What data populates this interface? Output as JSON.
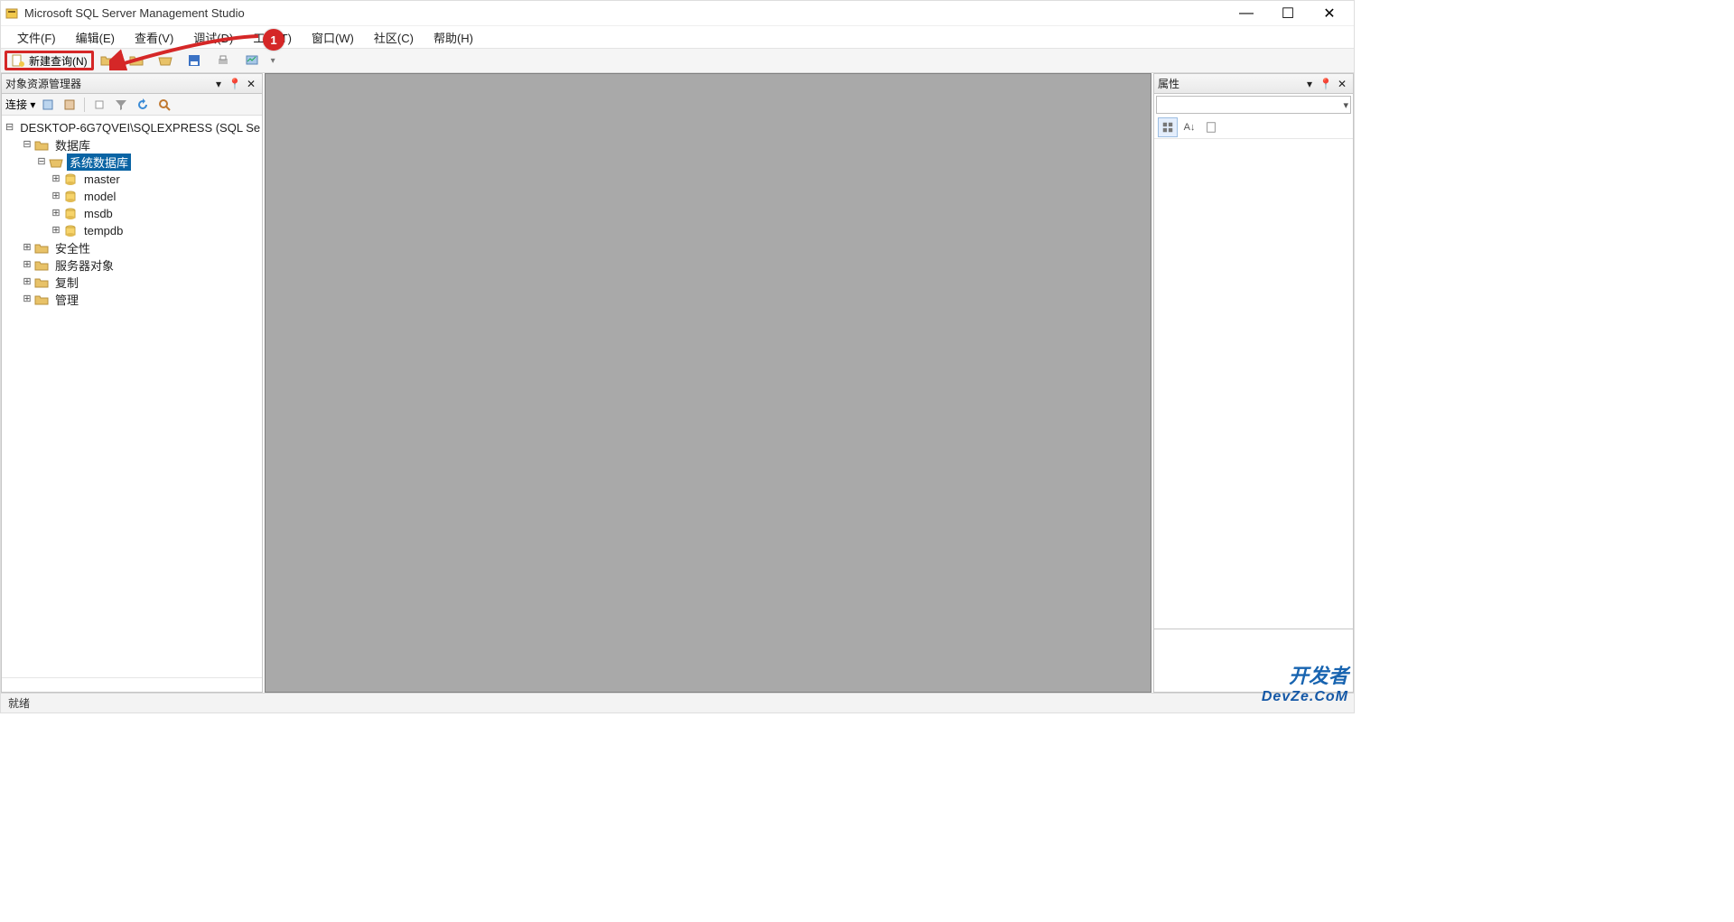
{
  "window": {
    "title": "Microsoft SQL Server Management Studio"
  },
  "menu": {
    "file": "文件(F)",
    "edit": "编辑(E)",
    "view": "查看(V)",
    "debug": "调试(D)",
    "tools": "工具(T)",
    "window": "窗口(W)",
    "community": "社区(C)",
    "help": "帮助(H)"
  },
  "toolbar": {
    "new_query": "新建查询(N)"
  },
  "annotation": {
    "badge": "1"
  },
  "object_explorer": {
    "title": "对象资源管理器",
    "connect_label": "连接 ▾",
    "server": "DESKTOP-6G7QVEI\\SQLEXPRESS (SQL Se",
    "nodes": {
      "databases": "数据库",
      "system_databases": "系统数据库",
      "db_master": "master",
      "db_model": "model",
      "db_msdb": "msdb",
      "db_tempdb": "tempdb",
      "security": "安全性",
      "server_objects": "服务器对象",
      "replication": "复制",
      "management": "管理"
    }
  },
  "properties": {
    "title": "属性"
  },
  "status": {
    "ready": "就绪"
  },
  "watermark": {
    "line1": "开发者",
    "line2": "DevZe.CoM"
  },
  "glyphs": {
    "minus": "⊟",
    "plus": "⊞",
    "tri_down": "▾",
    "close": "✕",
    "pin": "📌",
    "min": "—",
    "max": "☐"
  }
}
